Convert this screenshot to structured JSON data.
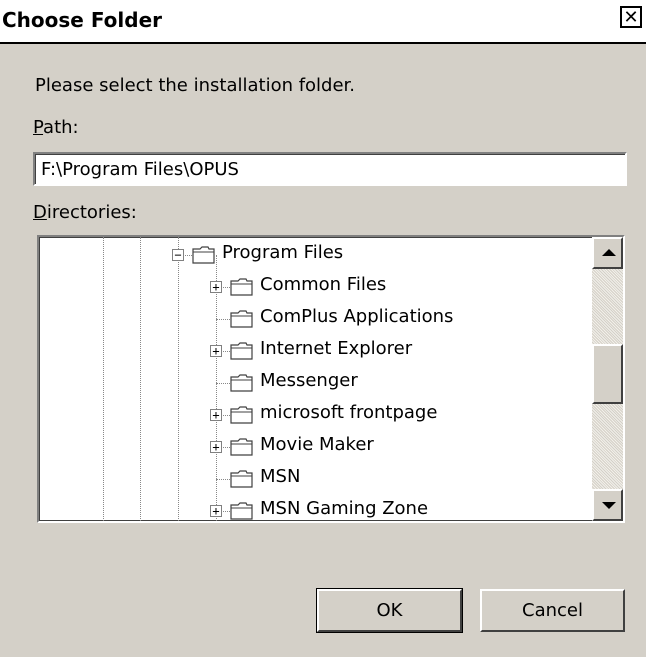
{
  "window": {
    "title": "Choose Folder",
    "close_glyph": "✕"
  },
  "prompt": "Please select the installation folder.",
  "path": {
    "label_accel": "P",
    "label_rest": "ath:",
    "value": "F:\\Program Files\\OPUS"
  },
  "directories": {
    "label_accel": "D",
    "label_rest": "irectories:",
    "items": [
      {
        "label": "Program Files",
        "expander": "−",
        "icon": "folder-icon"
      },
      {
        "label": "Common Files",
        "expander": "+",
        "icon": "folder-icon"
      },
      {
        "label": "ComPlus Applications",
        "expander": "",
        "icon": "folder-icon"
      },
      {
        "label": "Internet Explorer",
        "expander": "+",
        "icon": "folder-icon"
      },
      {
        "label": "Messenger",
        "expander": "",
        "icon": "folder-icon"
      },
      {
        "label": "microsoft frontpage",
        "expander": "+",
        "icon": "folder-icon"
      },
      {
        "label": "Movie Maker",
        "expander": "+",
        "icon": "folder-icon"
      },
      {
        "label": "MSN",
        "expander": "",
        "icon": "folder-icon"
      },
      {
        "label": "MSN Gaming Zone",
        "expander": "+",
        "icon": "folder-icon"
      }
    ]
  },
  "buttons": {
    "ok": "OK",
    "cancel": "Cancel"
  }
}
